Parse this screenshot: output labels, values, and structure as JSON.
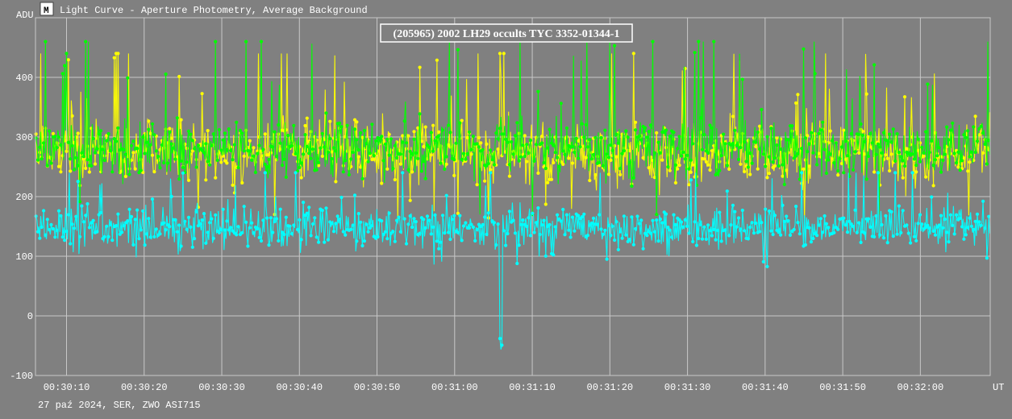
{
  "window": {
    "title": "Light Curve - Aperture Photometry, Average Background",
    "icon": "light-curve-app-icon"
  },
  "chart_data": {
    "type": "line",
    "title": "(205965) 2002 LH29 occults TYC 3352-01344-1",
    "ylabel": "ADU",
    "xlabel": "UT",
    "ylim": [
      -100,
      500
    ],
    "yticks": [
      -100,
      0,
      100,
      200,
      300,
      400
    ],
    "xlim_seconds": [
      606,
      729
    ],
    "xticks": [
      {
        "t": 610,
        "label": "00:30:10"
      },
      {
        "t": 620,
        "label": "00:30:20"
      },
      {
        "t": 630,
        "label": "00:30:30"
      },
      {
        "t": 640,
        "label": "00:30:40"
      },
      {
        "t": 650,
        "label": "00:30:50"
      },
      {
        "t": 660,
        "label": "00:31:00"
      },
      {
        "t": 670,
        "label": "00:31:10"
      },
      {
        "t": 680,
        "label": "00:31:20"
      },
      {
        "t": 690,
        "label": "00:31:30"
      },
      {
        "t": 700,
        "label": "00:31:40"
      },
      {
        "t": 710,
        "label": "00:31:50"
      },
      {
        "t": 720,
        "label": "00:32:00"
      }
    ],
    "grid": true,
    "series": [
      {
        "color": "#ffff00",
        "mean": 275,
        "spread": 45,
        "min": 130,
        "max": 440
      },
      {
        "color": "#00ff00",
        "mean": 280,
        "spread": 42,
        "min": 170,
        "max": 460
      },
      {
        "color": "#00ffff",
        "mean": 148,
        "spread": 30,
        "min": 15,
        "max": 240,
        "event": {
          "start": 665.8,
          "end": 666.2,
          "min_value": -62
        }
      }
    ],
    "footer": "27 paź 2024, SER, ZWO ASI715"
  }
}
